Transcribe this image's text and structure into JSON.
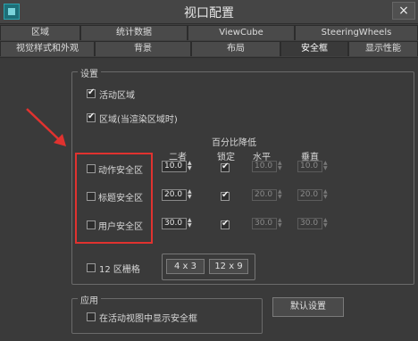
{
  "window": {
    "title": "视口配置",
    "close_symbol": "×"
  },
  "tabs_row1": [
    "区域",
    "统计数据",
    "ViewCube",
    "SteeringWheels"
  ],
  "tabs_row2": [
    "视觉样式和外观",
    "背景",
    "布局",
    "安全框",
    "显示性能"
  ],
  "active_tab": "安全框",
  "settings": {
    "group_label": "设置",
    "live_area": {
      "label": "活动区域",
      "checked": true
    },
    "region": {
      "label": "区域(当渲染区域时)",
      "checked": true
    },
    "percent_header": "百分比降低",
    "col_uniform": "二者",
    "col_lock": "锁定",
    "col_horizontal": "水平",
    "col_vertical": "垂直",
    "rows": [
      {
        "label": "动作安全区",
        "checked": false,
        "uniform": "10.0",
        "locked": true,
        "horizontal": "10.0",
        "vertical": "10.0"
      },
      {
        "label": "标题安全区",
        "checked": false,
        "uniform": "20.0",
        "locked": true,
        "horizontal": "20.0",
        "vertical": "20.0"
      },
      {
        "label": "用户安全区",
        "checked": false,
        "uniform": "30.0",
        "locked": true,
        "horizontal": "30.0",
        "vertical": "30.0"
      }
    ],
    "grid": {
      "label": "12 区栅格",
      "checked": false,
      "btn_4x3": "4 x 3",
      "btn_12x9": "12 x 9"
    }
  },
  "application": {
    "group_label": "应用",
    "show_in_active": {
      "label": "在活动视图中显示安全框",
      "checked": false
    }
  },
  "defaults_button": "默认设置",
  "highlight_color": "#e0322f"
}
